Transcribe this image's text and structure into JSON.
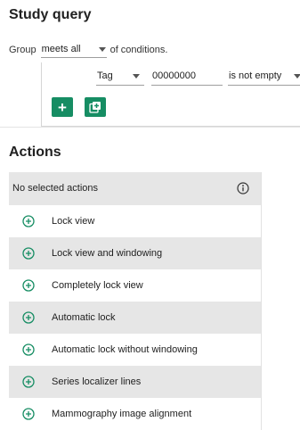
{
  "query": {
    "title": "Study query",
    "group_label": "Group",
    "group_mode": "meets all",
    "group_suffix": "of conditions.",
    "condition": {
      "field": "Tag",
      "value": "00000000",
      "operator": "is not empty"
    },
    "add_condition_icon": "plus-icon",
    "add_group_icon": "library-add-icon"
  },
  "actions": {
    "title": "Actions",
    "header": "No selected actions",
    "info_icon": "info-icon",
    "items": [
      {
        "label": "Lock view"
      },
      {
        "label": "Lock view and windowing"
      },
      {
        "label": "Completely lock view"
      },
      {
        "label": "Automatic lock"
      },
      {
        "label": "Automatic lock without windowing"
      },
      {
        "label": "Series localizer lines"
      },
      {
        "label": "Mammography image alignment"
      }
    ]
  },
  "colors": {
    "accent": "#168d63",
    "row_alt": "#e6e6e6"
  }
}
